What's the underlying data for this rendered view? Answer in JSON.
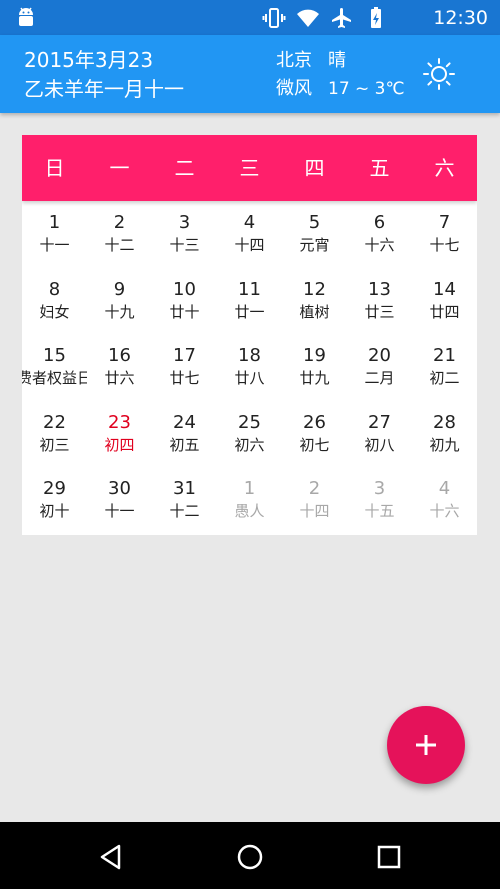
{
  "status_bar": {
    "time": "12:30",
    "icons": [
      "android-icon",
      "vibrate-icon",
      "wifi-icon",
      "airplane-mode-icon",
      "battery-icon"
    ]
  },
  "header": {
    "date": "2015年3月23",
    "lunar_date": "乙未羊年一月十一",
    "city": "北京",
    "weather": "晴",
    "wind": "微风",
    "temperature": "17 ~ 3℃",
    "weather_icon": "sun-icon"
  },
  "calendar": {
    "weekdays": [
      "日",
      "一",
      "二",
      "三",
      "四",
      "五",
      "六"
    ],
    "days": [
      {
        "day": "1",
        "lunar": "十一"
      },
      {
        "day": "2",
        "lunar": "十二"
      },
      {
        "day": "3",
        "lunar": "十三"
      },
      {
        "day": "4",
        "lunar": "十四"
      },
      {
        "day": "5",
        "lunar": "元宵"
      },
      {
        "day": "6",
        "lunar": "十六"
      },
      {
        "day": "7",
        "lunar": "十七"
      },
      {
        "day": "8",
        "lunar": "妇女"
      },
      {
        "day": "9",
        "lunar": "十九"
      },
      {
        "day": "10",
        "lunar": "廿十"
      },
      {
        "day": "11",
        "lunar": "廿一"
      },
      {
        "day": "12",
        "lunar": "植树"
      },
      {
        "day": "13",
        "lunar": "廿三"
      },
      {
        "day": "14",
        "lunar": "廿四"
      },
      {
        "day": "15",
        "lunar": "费者权益日"
      },
      {
        "day": "16",
        "lunar": "廿六"
      },
      {
        "day": "17",
        "lunar": "廿七"
      },
      {
        "day": "18",
        "lunar": "廿八"
      },
      {
        "day": "19",
        "lunar": "廿九"
      },
      {
        "day": "20",
        "lunar": "二月"
      },
      {
        "day": "21",
        "lunar": "初二"
      },
      {
        "day": "22",
        "lunar": "初三"
      },
      {
        "day": "23",
        "lunar": "初四",
        "today": true
      },
      {
        "day": "24",
        "lunar": "初五"
      },
      {
        "day": "25",
        "lunar": "初六"
      },
      {
        "day": "26",
        "lunar": "初七"
      },
      {
        "day": "27",
        "lunar": "初八"
      },
      {
        "day": "28",
        "lunar": "初九"
      },
      {
        "day": "29",
        "lunar": "初十"
      },
      {
        "day": "30",
        "lunar": "十一"
      },
      {
        "day": "31",
        "lunar": "十二"
      },
      {
        "day": "1",
        "lunar": "愚人",
        "other_month": true
      },
      {
        "day": "2",
        "lunar": "十四",
        "other_month": true
      },
      {
        "day": "3",
        "lunar": "十五",
        "other_month": true
      },
      {
        "day": "4",
        "lunar": "十六",
        "other_month": true
      }
    ]
  },
  "fab": {
    "icon": "plus-icon"
  },
  "nav_bar": {
    "icons": [
      "back-icon",
      "home-icon",
      "recents-icon"
    ]
  },
  "colors": {
    "status_bar": "#1976d2",
    "app_bar": "#2196f3",
    "week_header": "#ff1f6b",
    "today": "#e0001e",
    "other_month": "#a8a8a8",
    "fab": "#e5125a"
  }
}
